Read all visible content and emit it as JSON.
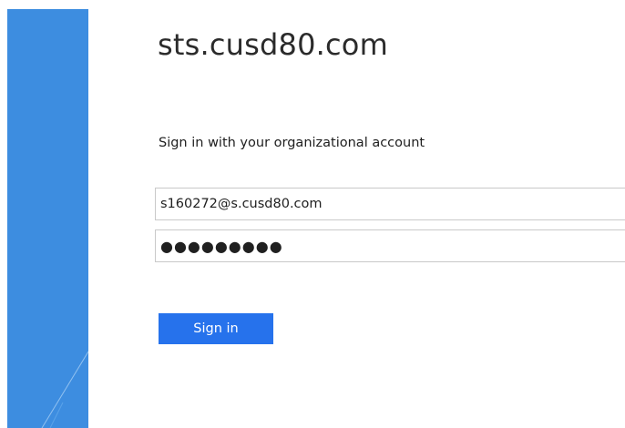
{
  "sidebar": {
    "color": "#3d8de0"
  },
  "header": {
    "host": "sts.cusd80.com"
  },
  "form": {
    "heading": "Sign in with your organizational account",
    "username_value": "s160272@s.cusd80.com",
    "password_value": "●●●●●●●●●",
    "sign_in_label": "Sign in"
  },
  "colors": {
    "accent": "#2672ec",
    "field_border": "#c9c9c9"
  }
}
